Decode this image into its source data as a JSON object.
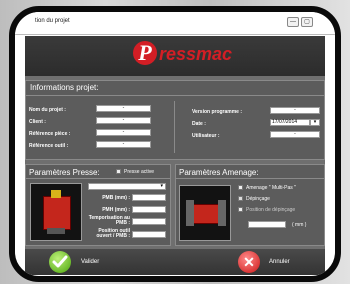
{
  "window": {
    "title": "tion du projet",
    "min_label": "—",
    "max_label": "▢"
  },
  "brand": {
    "logo_letter": "P",
    "name": "ressmac",
    "color": "#d31e25"
  },
  "info": {
    "heading": "Informations projet:",
    "project_name_label": "Nom du projet :",
    "project_name_value": "-",
    "client_label": "Client :",
    "client_value": "-",
    "part_ref_label": "Référence pièce :",
    "part_ref_value": "-",
    "tool_ref_label": "Référence outil :",
    "tool_ref_value": "-",
    "version_label": "Version programme :",
    "version_value": "-",
    "date_label": "Date :",
    "date_value": "17/07/2014",
    "user_label": "Utilisateur :",
    "user_value": "-"
  },
  "press": {
    "heading": "Paramètres Presse:",
    "active_label": "Presse active",
    "pmb_label": "PMB (mm) :",
    "pmh_label": "PMH (mm) :",
    "delay_label": "Temporisation au PMB :",
    "tool_pos_label": "Position outil ouvert / PMB :"
  },
  "feed": {
    "heading": "Paramètres Amenage:",
    "option_multi": "Amenage \" Multi-Pas \"",
    "option_unwind": "Dépinçage",
    "option_unwind_pos": "Position de dépinçage",
    "unit": "( mm )"
  },
  "actions": {
    "validate": "Valider",
    "cancel": "Annuler",
    "cancel_icon": "✕"
  }
}
